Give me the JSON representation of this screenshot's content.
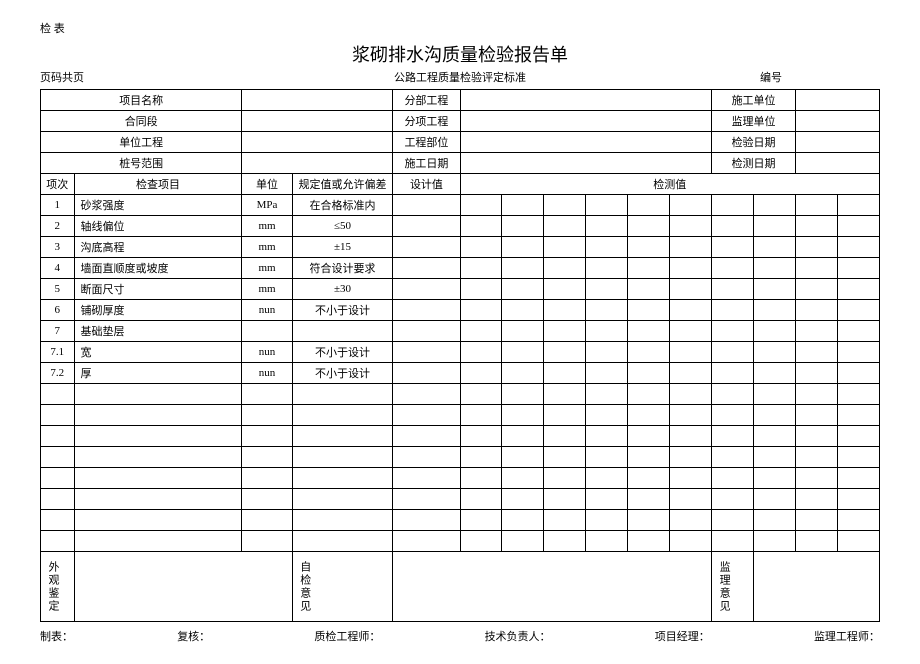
{
  "top_label": "检 表",
  "title": "浆砌排水沟质量检验报告单",
  "page_info": "页码共页",
  "standard_text": "公路工程质量检验评定标准",
  "number_label": "编号",
  "header_rows": [
    {
      "l1": "项目名称",
      "l2": "分部工程",
      "l3": "施工单位"
    },
    {
      "l1": "合同段",
      "l2": "分项工程",
      "l3": "监理单位"
    },
    {
      "l1": "单位工程",
      "l2": "工程部位",
      "l3": "检验日期"
    },
    {
      "l1": "桩号范围",
      "l2": "施工日期",
      "l3": "检测日期"
    }
  ],
  "columns": {
    "seq": "项次",
    "item": "检查项目",
    "unit": "单位",
    "spec": "规定值或允许偏差",
    "design": "设计值",
    "measured": "检测值"
  },
  "rows": [
    {
      "seq": "1",
      "item": "砂浆强度",
      "unit": "MPa",
      "spec": "在合格标准内"
    },
    {
      "seq": "2",
      "item": "轴线偏位",
      "unit": "mm",
      "spec": "≤50"
    },
    {
      "seq": "3",
      "item": "沟底高程",
      "unit": "mm",
      "spec": "±15"
    },
    {
      "seq": "4",
      "item": "墙面直顺度或坡度",
      "unit": "mm",
      "spec": "符合设计要求"
    },
    {
      "seq": "5",
      "item": "断面尺寸",
      "unit": "mm",
      "spec": "±30"
    },
    {
      "seq": "6",
      "item": "铺砌厚度",
      "unit": "nun",
      "spec": "不小于设计"
    },
    {
      "seq": "7",
      "item": "基础垫层",
      "unit": "",
      "spec": ""
    },
    {
      "seq": "7.1",
      "item": "宽",
      "unit": "nun",
      "spec": "不小于设计"
    },
    {
      "seq": "7.2",
      "item": "厚",
      "unit": "nun",
      "spec": "不小于设计"
    }
  ],
  "bottom_labels": {
    "appearance": "外观鉴定",
    "self_check": "自检意见",
    "supervise": "监理意见"
  },
  "footer": {
    "f1": "制表：",
    "f2": "复核：",
    "f3": "质检工程师：",
    "f4": "技术负责人：",
    "f5": "项目经理：",
    "f6": "监理工程师："
  }
}
